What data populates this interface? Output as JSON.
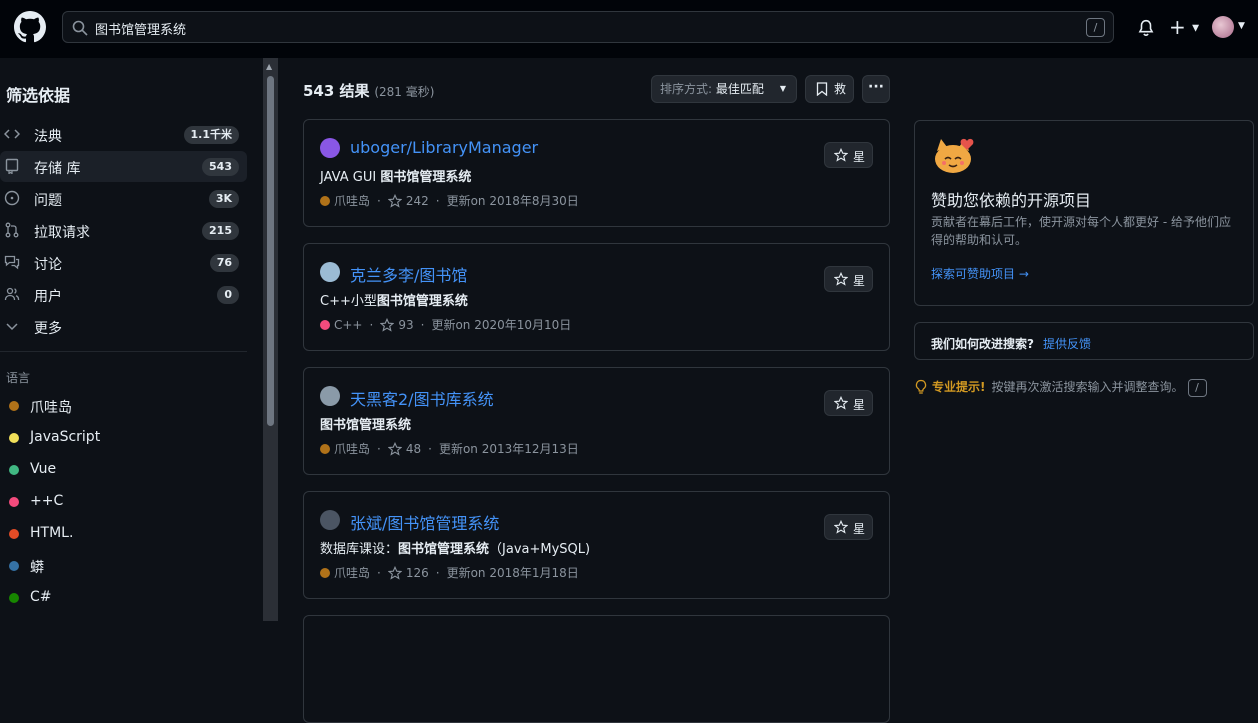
{
  "header": {
    "search_value": "图书馆管理系统",
    "search_shortcut": "/"
  },
  "sidebar": {
    "title": "筛选依据",
    "items": [
      {
        "label": "法典",
        "count": "1.1千米",
        "icon": "code-icon"
      },
      {
        "label": "存储 库",
        "count": "543",
        "icon": "repo-icon",
        "active": true
      },
      {
        "label": "问题",
        "count": "3K",
        "icon": "issue-icon"
      },
      {
        "label": "拉取请求",
        "count": "215",
        "icon": "pull-request-icon"
      },
      {
        "label": "讨论",
        "count": "76",
        "icon": "discussion-icon"
      },
      {
        "label": "用户",
        "count": "0",
        "icon": "people-icon"
      },
      {
        "label": "更多",
        "count": "",
        "icon": "chevron-down-icon"
      }
    ],
    "lang_title": "语言",
    "languages": [
      {
        "label": "爪哇岛",
        "color": "#b07219"
      },
      {
        "label": "JavaScript",
        "color": "#f1e05a"
      },
      {
        "label": "Vue",
        "color": "#41b883"
      },
      {
        "label": "++C",
        "color": "#f34b7d"
      },
      {
        "label": "HTML.",
        "color": "#e34c26"
      },
      {
        "label": "蟒",
        "color": "#3572A5"
      },
      {
        "label": "C#",
        "color": "#178600"
      }
    ]
  },
  "results": {
    "count": "543 结果",
    "time": "(281 毫秒)",
    "sort_key": "排序方式:",
    "sort_value": "最佳匹配",
    "save_label": "救"
  },
  "repos": [
    {
      "name": "uboger/LibraryManager",
      "desc_prefix": "JAVA GUI ",
      "desc_bold": "图书馆管理系统",
      "desc_suffix": "",
      "lang": "爪哇岛",
      "lang_color": "#b07219",
      "stars": "242",
      "updated": "更新on 2018年8月30日",
      "star_label": "星",
      "avatar_color": "#8957e5"
    },
    {
      "name": "克兰多李/图书馆",
      "desc_prefix": "C++小型",
      "desc_bold": "图书馆管理系统",
      "desc_suffix": "",
      "lang": "C++",
      "lang_color": "#f34b7d",
      "stars": "93",
      "updated": "更新on 2020年10月10日",
      "star_label": "星",
      "avatar_color": "#9bbbd4"
    },
    {
      "name": "天黑客2/图书库系统",
      "desc_prefix": "",
      "desc_bold": "图书馆管理系统",
      "desc_suffix": "",
      "lang": "爪哇岛",
      "lang_color": "#b07219",
      "stars": "48",
      "updated": "更新on 2013年12月13日",
      "star_label": "星",
      "avatar_color": "#8a9aa8"
    },
    {
      "name": "张斌/图书馆管理系统",
      "desc_prefix": "数据库课设：",
      "desc_bold": "图书馆管理系统",
      "desc_suffix": "（Java+MySQL)",
      "lang": "爪哇岛",
      "lang_color": "#b07219",
      "stars": "126",
      "updated": "更新on 2018年1月18日",
      "star_label": "星",
      "avatar_color": "#4b5563"
    }
  ],
  "sponsor": {
    "title": "赞助您依赖的开源项目",
    "body": "贡献者在幕后工作，使开源对每个人都更好 - 给予他们应得的帮助和认可。",
    "link": "探索可赞助项目 →"
  },
  "feedback": {
    "question": "我们如何改进搜索?",
    "action": "提供反馈"
  },
  "protip": {
    "strong": "专业提示!",
    "text": "按键再次激活搜索输入并调整查询。",
    "key": "/"
  }
}
